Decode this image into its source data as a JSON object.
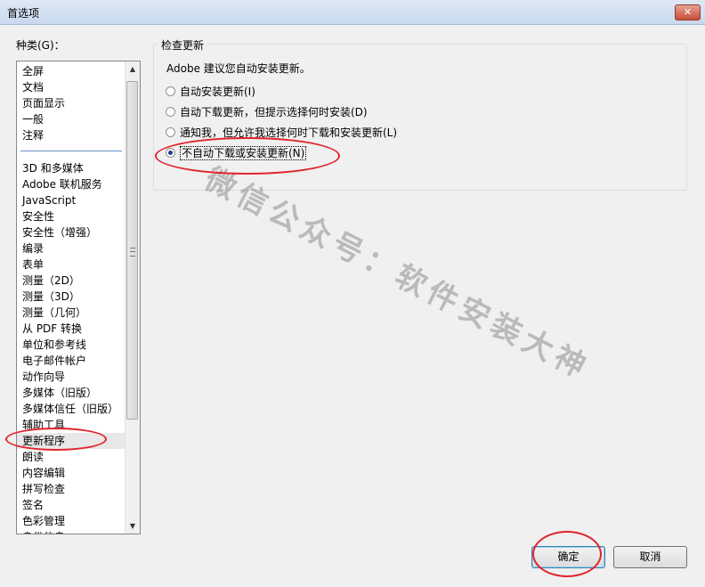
{
  "window": {
    "title": "首选项",
    "close_symbol": "✕"
  },
  "categories": {
    "label": "种类(G)：",
    "group1": [
      "全屏",
      "文档",
      "页面显示",
      "一般",
      "注释"
    ],
    "group2": [
      "3D 和多媒体",
      "Adobe 联机服务",
      "JavaScript",
      "安全性",
      "安全性（增强）",
      "编录",
      "表单",
      "测量（2D）",
      "测量（3D）",
      "测量（几何）",
      "从 PDF 转换",
      "单位和参考线",
      "电子邮件帐户",
      "动作向导",
      "多媒体（旧版）",
      "多媒体信任（旧版）",
      "辅助工具",
      "更新程序",
      "朗读",
      "内容编辑",
      "拼写检查",
      "签名",
      "色彩管理",
      "身份信息"
    ],
    "selected": "更新程序"
  },
  "update": {
    "group_title": "检查更新",
    "note": "Adobe 建议您自动安装更新。",
    "options": [
      {
        "label": "自动安装更新(I)",
        "checked": false
      },
      {
        "label": "自动下载更新，但提示选择何时安装(D)",
        "checked": false
      },
      {
        "label": "通知我，但允许我选择何时下载和安装更新(L)",
        "checked": false
      },
      {
        "label": "不自动下载或安装更新(N)",
        "checked": true
      }
    ]
  },
  "buttons": {
    "ok": "确定",
    "cancel": "取消"
  },
  "watermark": "微信公众号：软件安装大神",
  "colors": {
    "annotation": "#e0242c",
    "titlebar": "#c8d9ee",
    "selected_radio": "#1b3d84"
  }
}
